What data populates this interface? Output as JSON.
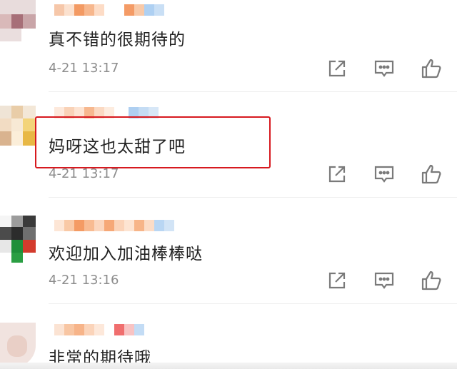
{
  "comments": [
    {
      "text": "真不错的很期待的",
      "time": "4-21 13:17"
    },
    {
      "text": "妈呀这也太甜了吧",
      "time": "4-21 13:17"
    },
    {
      "text": "欢迎加入加油棒棒哒",
      "time": "4-21 13:16"
    },
    {
      "text": "非常的期待哦",
      "time": ""
    }
  ],
  "actions": {
    "share_icon": "share-icon",
    "reply_icon": "comment-icon",
    "like_icon": "thumbs-up-icon"
  },
  "colors": {
    "highlight_border": "#d7191f",
    "text": "#222222",
    "timestamp": "#8d8d8d",
    "icon": "#7a7a7a"
  }
}
